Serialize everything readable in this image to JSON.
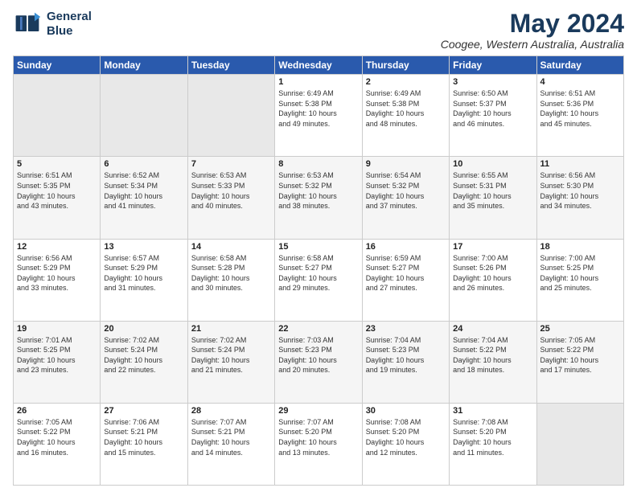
{
  "header": {
    "logo_line1": "General",
    "logo_line2": "Blue",
    "title": "May 2024",
    "subtitle": "Coogee, Western Australia, Australia"
  },
  "weekdays": [
    "Sunday",
    "Monday",
    "Tuesday",
    "Wednesday",
    "Thursday",
    "Friday",
    "Saturday"
  ],
  "weeks": [
    [
      {
        "num": "",
        "info": ""
      },
      {
        "num": "",
        "info": ""
      },
      {
        "num": "",
        "info": ""
      },
      {
        "num": "1",
        "info": "Sunrise: 6:49 AM\nSunset: 5:38 PM\nDaylight: 10 hours\nand 49 minutes."
      },
      {
        "num": "2",
        "info": "Sunrise: 6:49 AM\nSunset: 5:38 PM\nDaylight: 10 hours\nand 48 minutes."
      },
      {
        "num": "3",
        "info": "Sunrise: 6:50 AM\nSunset: 5:37 PM\nDaylight: 10 hours\nand 46 minutes."
      },
      {
        "num": "4",
        "info": "Sunrise: 6:51 AM\nSunset: 5:36 PM\nDaylight: 10 hours\nand 45 minutes."
      }
    ],
    [
      {
        "num": "5",
        "info": "Sunrise: 6:51 AM\nSunset: 5:35 PM\nDaylight: 10 hours\nand 43 minutes."
      },
      {
        "num": "6",
        "info": "Sunrise: 6:52 AM\nSunset: 5:34 PM\nDaylight: 10 hours\nand 41 minutes."
      },
      {
        "num": "7",
        "info": "Sunrise: 6:53 AM\nSunset: 5:33 PM\nDaylight: 10 hours\nand 40 minutes."
      },
      {
        "num": "8",
        "info": "Sunrise: 6:53 AM\nSunset: 5:32 PM\nDaylight: 10 hours\nand 38 minutes."
      },
      {
        "num": "9",
        "info": "Sunrise: 6:54 AM\nSunset: 5:32 PM\nDaylight: 10 hours\nand 37 minutes."
      },
      {
        "num": "10",
        "info": "Sunrise: 6:55 AM\nSunset: 5:31 PM\nDaylight: 10 hours\nand 35 minutes."
      },
      {
        "num": "11",
        "info": "Sunrise: 6:56 AM\nSunset: 5:30 PM\nDaylight: 10 hours\nand 34 minutes."
      }
    ],
    [
      {
        "num": "12",
        "info": "Sunrise: 6:56 AM\nSunset: 5:29 PM\nDaylight: 10 hours\nand 33 minutes."
      },
      {
        "num": "13",
        "info": "Sunrise: 6:57 AM\nSunset: 5:29 PM\nDaylight: 10 hours\nand 31 minutes."
      },
      {
        "num": "14",
        "info": "Sunrise: 6:58 AM\nSunset: 5:28 PM\nDaylight: 10 hours\nand 30 minutes."
      },
      {
        "num": "15",
        "info": "Sunrise: 6:58 AM\nSunset: 5:27 PM\nDaylight: 10 hours\nand 29 minutes."
      },
      {
        "num": "16",
        "info": "Sunrise: 6:59 AM\nSunset: 5:27 PM\nDaylight: 10 hours\nand 27 minutes."
      },
      {
        "num": "17",
        "info": "Sunrise: 7:00 AM\nSunset: 5:26 PM\nDaylight: 10 hours\nand 26 minutes."
      },
      {
        "num": "18",
        "info": "Sunrise: 7:00 AM\nSunset: 5:25 PM\nDaylight: 10 hours\nand 25 minutes."
      }
    ],
    [
      {
        "num": "19",
        "info": "Sunrise: 7:01 AM\nSunset: 5:25 PM\nDaylight: 10 hours\nand 23 minutes."
      },
      {
        "num": "20",
        "info": "Sunrise: 7:02 AM\nSunset: 5:24 PM\nDaylight: 10 hours\nand 22 minutes."
      },
      {
        "num": "21",
        "info": "Sunrise: 7:02 AM\nSunset: 5:24 PM\nDaylight: 10 hours\nand 21 minutes."
      },
      {
        "num": "22",
        "info": "Sunrise: 7:03 AM\nSunset: 5:23 PM\nDaylight: 10 hours\nand 20 minutes."
      },
      {
        "num": "23",
        "info": "Sunrise: 7:04 AM\nSunset: 5:23 PM\nDaylight: 10 hours\nand 19 minutes."
      },
      {
        "num": "24",
        "info": "Sunrise: 7:04 AM\nSunset: 5:22 PM\nDaylight: 10 hours\nand 18 minutes."
      },
      {
        "num": "25",
        "info": "Sunrise: 7:05 AM\nSunset: 5:22 PM\nDaylight: 10 hours\nand 17 minutes."
      }
    ],
    [
      {
        "num": "26",
        "info": "Sunrise: 7:05 AM\nSunset: 5:22 PM\nDaylight: 10 hours\nand 16 minutes."
      },
      {
        "num": "27",
        "info": "Sunrise: 7:06 AM\nSunset: 5:21 PM\nDaylight: 10 hours\nand 15 minutes."
      },
      {
        "num": "28",
        "info": "Sunrise: 7:07 AM\nSunset: 5:21 PM\nDaylight: 10 hours\nand 14 minutes."
      },
      {
        "num": "29",
        "info": "Sunrise: 7:07 AM\nSunset: 5:20 PM\nDaylight: 10 hours\nand 13 minutes."
      },
      {
        "num": "30",
        "info": "Sunrise: 7:08 AM\nSunset: 5:20 PM\nDaylight: 10 hours\nand 12 minutes."
      },
      {
        "num": "31",
        "info": "Sunrise: 7:08 AM\nSunset: 5:20 PM\nDaylight: 10 hours\nand 11 minutes."
      },
      {
        "num": "",
        "info": ""
      }
    ]
  ]
}
